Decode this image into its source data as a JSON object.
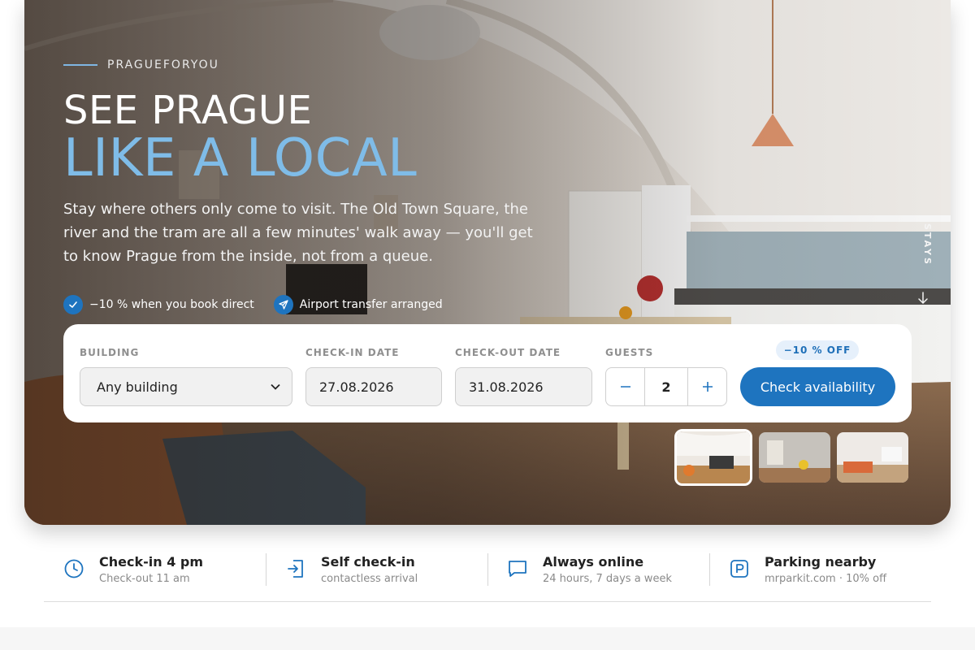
{
  "hero": {
    "eyebrow": "PRAGUEFORYOU",
    "headline_line1": "SEE PRAGUE",
    "headline_line2": "LIKE A LOCAL",
    "lead": "Stay where others only come to visit. The Old Town Square, the river and the tram are all a few minutes' walk away — you'll get to know Prague from the inside, not from a queue.",
    "perks": [
      {
        "icon": "check-icon",
        "text": "−10 % when you book direct"
      },
      {
        "icon": "paper-plane-icon",
        "text": "Airport transfer arranged"
      }
    ],
    "side_label": "STAYS",
    "side_icon": "arrow-down-icon"
  },
  "booking": {
    "building_label": "BUILDING",
    "building_value": "Any building",
    "checkin_label": "CHECK-IN DATE",
    "checkin_value": "27.08.2026",
    "checkout_label": "CHECK-OUT DATE",
    "checkout_value": "31.08.2026",
    "guests_label": "GUESTS",
    "guests_value": "2",
    "discount_badge": "−10 % OFF",
    "cta_label": "Check availability"
  },
  "thumbnails": {
    "count": 3,
    "active_index": 0
  },
  "features": [
    {
      "icon": "clock-icon",
      "title": "Check-in 4 pm",
      "subtitle": "Check-out 11 am"
    },
    {
      "icon": "door-enter-icon",
      "title": "Self check-in",
      "subtitle": "contactless arrival"
    },
    {
      "icon": "chat-bubble-icon",
      "title": "Always online",
      "subtitle": "24 hours, 7 days a week"
    },
    {
      "icon": "parking-icon",
      "title": "Parking nearby",
      "subtitle": "mrparkit.com · 10% off"
    }
  ],
  "colors": {
    "accent": "#1e74bf",
    "headline_accent": "#7fbce8"
  }
}
